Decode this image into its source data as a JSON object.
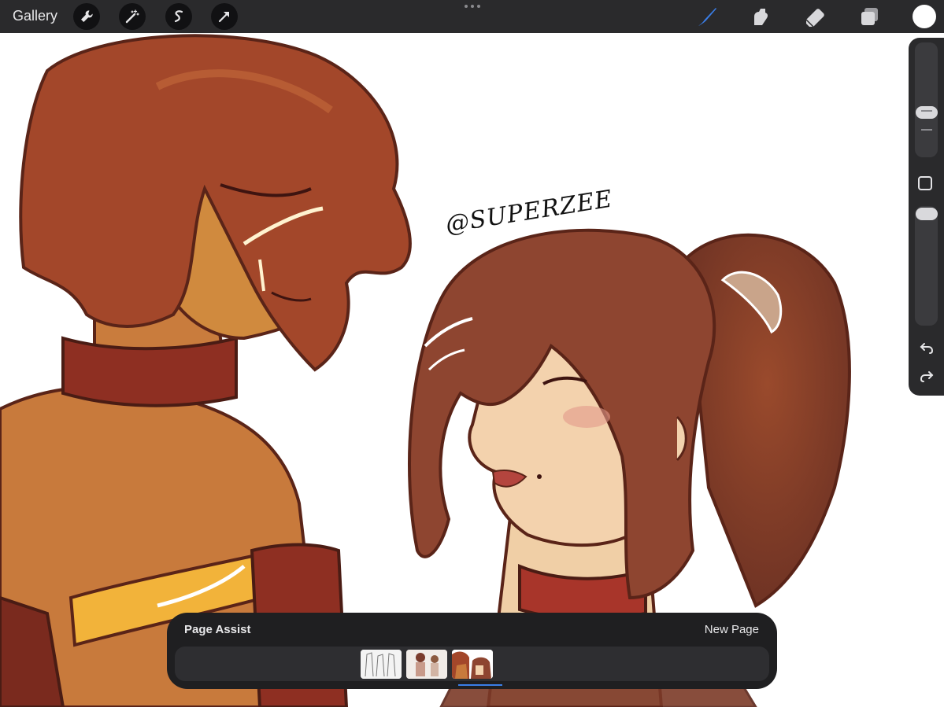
{
  "toolbar": {
    "gallery_label": "Gallery",
    "left_tools": [
      "wrench-icon",
      "magic-wand-icon",
      "selection-icon",
      "transform-arrow-icon"
    ],
    "right_tools": [
      "brush-icon",
      "smudge-icon",
      "eraser-icon",
      "layers-icon"
    ],
    "active_tool": "brush-icon",
    "active_tool_color": "#3a7ee8",
    "current_color": "#ffffff"
  },
  "sidebar": {
    "brush_size_level": 0.35,
    "opacity_level": 0.0,
    "icons": [
      "modify-square-icon",
      "undo-icon",
      "redo-icon"
    ]
  },
  "artwork": {
    "signature": "@SUPERZEE"
  },
  "page_assist": {
    "title": "Page Assist",
    "new_page_label": "New Page",
    "pages": [
      "page-1",
      "page-2",
      "page-3"
    ],
    "selected_page": 3
  },
  "colors": {
    "toolbar_bg": "#2a2a2c",
    "panel_bg": "#1f1f21",
    "accent": "#3a7ee8"
  }
}
